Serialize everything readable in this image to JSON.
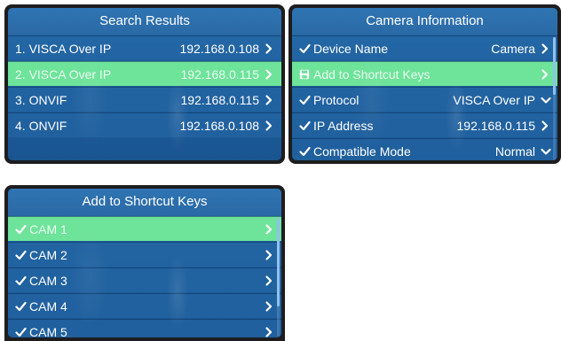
{
  "search_results": {
    "title": "Search Results",
    "items": [
      {
        "label": "1. VISCA Over IP",
        "value": "192.168.0.108"
      },
      {
        "label": "2. VISCA Over IP",
        "value": "192.168.0.115"
      },
      {
        "label": "3. ONVIF",
        "value": "192.168.0.115"
      },
      {
        "label": "4. ONVIF",
        "value": "192.168.0.108"
      }
    ]
  },
  "camera_information": {
    "title": "Camera Information",
    "items": [
      {
        "label": "Device Name",
        "value": "Camera",
        "icon": "checkmark-icon",
        "control": "chevron-right-icon"
      },
      {
        "label": "Add to Shortcut Keys",
        "value": "",
        "icon": "save-icon",
        "control": "chevron-right-icon"
      },
      {
        "label": "Protocol",
        "value": "VISCA Over IP",
        "icon": "checkmark-icon",
        "control": "chevron-down-icon"
      },
      {
        "label": "IP Address",
        "value": "192.168.0.115",
        "icon": "checkmark-icon",
        "control": "chevron-right-icon"
      },
      {
        "label": "Compatible Mode",
        "value": "Normal",
        "icon": "checkmark-icon",
        "control": "chevron-down-icon"
      }
    ]
  },
  "shortcut_keys": {
    "title": "Add to Shortcut Keys",
    "items": [
      {
        "label": "CAM 1"
      },
      {
        "label": "CAM 2"
      },
      {
        "label": "CAM 3"
      },
      {
        "label": "CAM 4"
      },
      {
        "label": "CAM 5"
      }
    ]
  },
  "colors": {
    "screen_bezel": "#1d1d1f",
    "panel_blue": "#1d5d9c",
    "selected_green": "#6ee39a",
    "text": "#ffffff"
  }
}
